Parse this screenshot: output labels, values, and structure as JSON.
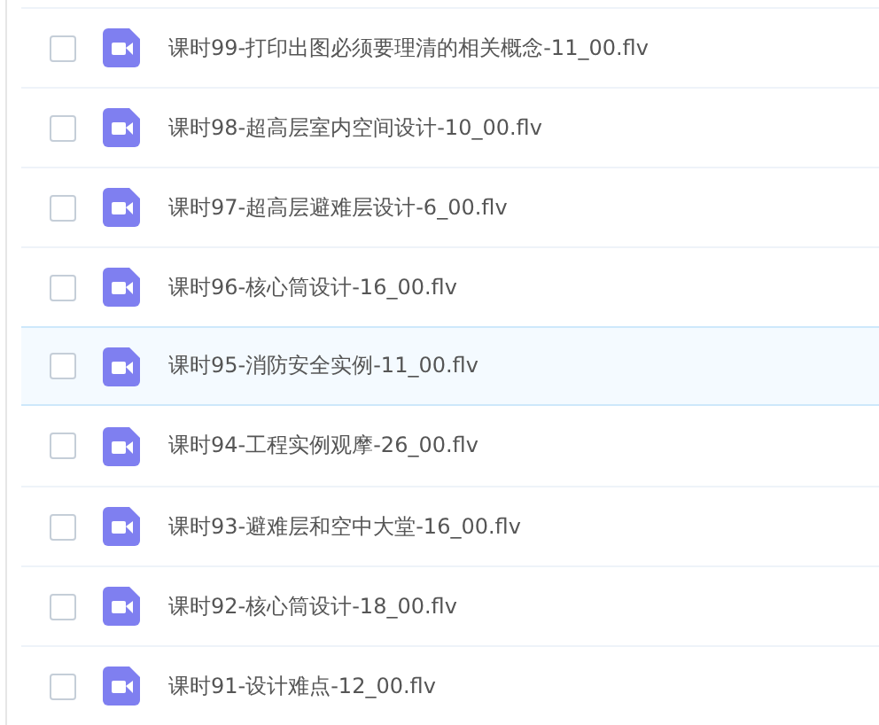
{
  "files": [
    {
      "name": "课时99-打印出图必须要理清的相关概念-11_00.flv",
      "checked": false,
      "highlighted": false
    },
    {
      "name": "课时98-超高层室内空间设计-10_00.flv",
      "checked": false,
      "highlighted": false
    },
    {
      "name": "课时97-超高层避难层设计-6_00.flv",
      "checked": false,
      "highlighted": false
    },
    {
      "name": "课时96-核心筒设计-16_00.flv",
      "checked": false,
      "highlighted": false
    },
    {
      "name": "课时95-消防安全实例-11_00.flv",
      "checked": false,
      "highlighted": true
    },
    {
      "name": "课时94-工程实例观摩-26_00.flv",
      "checked": false,
      "highlighted": false
    },
    {
      "name": "课时93-避难层和空中大堂-16_00.flv",
      "checked": false,
      "highlighted": false
    },
    {
      "name": "课时92-核心筒设计-18_00.flv",
      "checked": false,
      "highlighted": false
    },
    {
      "name": "课时91-设计难点-12_00.flv",
      "checked": false,
      "highlighted": false
    }
  ]
}
